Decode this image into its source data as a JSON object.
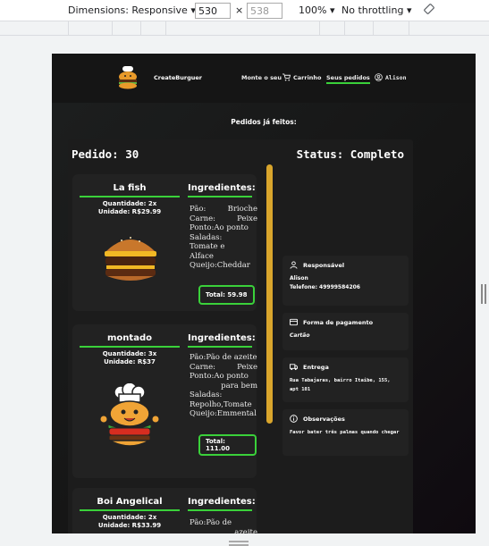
{
  "devtools": {
    "dimensions_label": "Dimensions: Responsive",
    "width": "530",
    "times": "×",
    "height": "538",
    "zoom": "100%",
    "throttle": "No throttling"
  },
  "nav": {
    "brand": "CreateBurguer",
    "links": [
      "Monte o seu",
      "Carrinho",
      "Seus pedidos"
    ],
    "user": "Alison"
  },
  "page": {
    "heading": "Pedidos já feitos:",
    "order_label": "Pedido: 30",
    "status_label": "Status: Completo"
  },
  "items": [
    {
      "name": "La fish",
      "quantity": "Quantidade: 2x",
      "unit": "Unidade: R$29.99",
      "ingredients_title": "Ingredientes:",
      "ingredients": [
        [
          "Pão:",
          "Brioche"
        ],
        [
          "Carne:",
          "Peixe"
        ],
        [
          "Ponto:Ao ponto",
          ""
        ],
        [
          "Saladas:",
          ""
        ],
        [
          "Tomate e",
          ""
        ],
        [
          "Alface",
          ""
        ],
        [
          "Queijo:Cheddar",
          ""
        ]
      ],
      "total": "Total: 59.98"
    },
    {
      "name": "montado",
      "quantity": "Quantidade: 3x",
      "unit": "Unidade: R$37",
      "ingredients_title": "Ingredientes:",
      "ingredients": [
        [
          "Pão:Pão de azeite",
          ""
        ],
        [
          "Carne:",
          "Peixe"
        ],
        [
          "Ponto:Ao ponto",
          ""
        ],
        [
          "",
          "para bem"
        ],
        [
          "Saladas:",
          ""
        ],
        [
          "Repolho,Tomate",
          ""
        ],
        [
          "Queijo:Emmental",
          ""
        ]
      ],
      "total": "Total: 111.00"
    },
    {
      "name": "Boi Angelical",
      "quantity": "Quantidade: 2x",
      "unit": "Unidade: R$33.99",
      "ingredients_title": "Ingredientes:",
      "ingredients": [
        [
          "Pão:Pão de",
          ""
        ],
        [
          "",
          "azeite"
        ]
      ],
      "total": ""
    }
  ],
  "info": {
    "responsavel_title": "Responsável",
    "responsavel_name": "Alison",
    "telefone": "Telefone: 49999584206",
    "pagamento_title": "Forma de pagamento",
    "pagamento_value": "Cartão",
    "entrega_title": "Entrega",
    "entrega_value": "Rua Tabajaras, bairro Itaibe, 155, apt 101",
    "obs_title": "Observações",
    "obs_value": "Favor bater três palmas quando chegar"
  },
  "colors": {
    "accent": "#3ad13a",
    "scroll": "#d9a52c",
    "bg": "#151515"
  },
  "icons": [
    "chevron-down-icon",
    "rotate-icon",
    "cart-icon",
    "user-icon",
    "person-icon",
    "card-icon",
    "truck-icon",
    "info-icon"
  ]
}
